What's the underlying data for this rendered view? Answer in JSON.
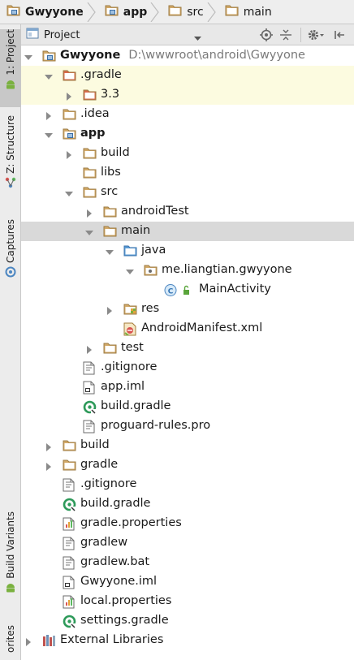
{
  "breadcrumb": {
    "items": [
      {
        "label": "Gwyyone",
        "bold": true,
        "icon": "module-folder-icon"
      },
      {
        "label": "app",
        "bold": true,
        "icon": "module-folder-icon"
      },
      {
        "label": "src",
        "bold": false,
        "icon": "folder-icon"
      },
      {
        "label": "main",
        "bold": false,
        "icon": "folder-icon"
      }
    ]
  },
  "left_strip": {
    "tabs": [
      {
        "label": "1: Project",
        "icon": "android-icon",
        "active": true
      },
      {
        "label": "Z: Structure",
        "icon": "structure-icon",
        "active": false
      },
      {
        "label": "Captures",
        "icon": "captures-icon",
        "active": false
      },
      {
        "label": "Build Variants",
        "icon": "android-icon",
        "active": false
      },
      {
        "label": "orites",
        "icon": "favorites-icon",
        "active": false
      }
    ]
  },
  "project_toolbar": {
    "view_select": "Project",
    "icons": [
      "locate-icon",
      "collapse-all-icon",
      "gear-icon",
      "hide-icon"
    ]
  },
  "tree": {
    "rows": [
      {
        "label": "Gwyyone",
        "path": "D:\\wwwroot\\android\\Gwyyone",
        "bold": true,
        "icon": "module-folder",
        "twisty": "expanded",
        "level": 0
      },
      {
        "label": ".gradle",
        "bold": false,
        "icon": "excluded-folder",
        "twisty": "expanded",
        "level": 1,
        "highlight": true
      },
      {
        "label": "3.3",
        "bold": false,
        "icon": "excluded-folder",
        "twisty": "collapsed",
        "level": 2,
        "highlight": true
      },
      {
        "label": ".idea",
        "bold": false,
        "icon": "folder",
        "twisty": "collapsed",
        "level": 1
      },
      {
        "label": "app",
        "bold": true,
        "icon": "module-folder",
        "twisty": "expanded",
        "level": 1
      },
      {
        "label": "build",
        "bold": false,
        "icon": "folder",
        "twisty": "collapsed",
        "level": 2
      },
      {
        "label": "libs",
        "bold": false,
        "icon": "folder",
        "twisty": "none",
        "level": 2
      },
      {
        "label": "src",
        "bold": false,
        "icon": "folder",
        "twisty": "expanded",
        "level": 2
      },
      {
        "label": "androidTest",
        "bold": false,
        "icon": "folder",
        "twisty": "collapsed",
        "level": 3
      },
      {
        "label": "main",
        "bold": false,
        "icon": "folder",
        "twisty": "expanded",
        "level": 3,
        "selected": true
      },
      {
        "label": "java",
        "bold": false,
        "icon": "source-folder",
        "twisty": "expanded",
        "level": 4
      },
      {
        "label": "me.liangtian.gwyyone",
        "bold": false,
        "icon": "package-folder",
        "twisty": "expanded",
        "level": 5
      },
      {
        "label": "MainActivity",
        "bold": false,
        "icon": "class",
        "twisty": "none",
        "level": 6
      },
      {
        "label": "res",
        "bold": false,
        "icon": "resource-folder",
        "twisty": "collapsed",
        "level": 4
      },
      {
        "label": "AndroidManifest.xml",
        "bold": false,
        "icon": "manifest",
        "twisty": "none",
        "level": 4
      },
      {
        "label": "test",
        "bold": false,
        "icon": "folder",
        "twisty": "collapsed",
        "level": 3
      },
      {
        "label": ".gitignore",
        "bold": false,
        "icon": "text-file",
        "twisty": "none",
        "level": 2
      },
      {
        "label": "app.iml",
        "bold": false,
        "icon": "iml-file",
        "twisty": "none",
        "level": 2
      },
      {
        "label": "build.gradle",
        "bold": false,
        "icon": "gradle-file",
        "twisty": "none",
        "level": 2
      },
      {
        "label": "proguard-rules.pro",
        "bold": false,
        "icon": "text-file",
        "twisty": "none",
        "level": 2
      },
      {
        "label": "build",
        "bold": false,
        "icon": "folder",
        "twisty": "collapsed",
        "level": 1
      },
      {
        "label": "gradle",
        "bold": false,
        "icon": "folder",
        "twisty": "collapsed",
        "level": 1
      },
      {
        "label": ".gitignore",
        "bold": false,
        "icon": "text-file",
        "twisty": "none",
        "level": 1
      },
      {
        "label": "build.gradle",
        "bold": false,
        "icon": "gradle-file",
        "twisty": "none",
        "level": 1
      },
      {
        "label": "gradle.properties",
        "bold": false,
        "icon": "properties-file",
        "twisty": "none",
        "level": 1
      },
      {
        "label": "gradlew",
        "bold": false,
        "icon": "text-file",
        "twisty": "none",
        "level": 1
      },
      {
        "label": "gradlew.bat",
        "bold": false,
        "icon": "text-file",
        "twisty": "none",
        "level": 1
      },
      {
        "label": "Gwyyone.iml",
        "bold": false,
        "icon": "iml-file",
        "twisty": "none",
        "level": 1
      },
      {
        "label": "local.properties",
        "bold": false,
        "icon": "properties-file",
        "twisty": "none",
        "level": 1
      },
      {
        "label": "settings.gradle",
        "bold": false,
        "icon": "gradle-file",
        "twisty": "none",
        "level": 1
      },
      {
        "label": "External Libraries",
        "bold": false,
        "icon": "libraries",
        "twisty": "collapsed",
        "level": 0
      }
    ]
  },
  "colors": {
    "folder": "#d2a968",
    "excluded": "#d86a4a",
    "source": "#5a9bd5",
    "gradle": "#2e9a5a",
    "selection": "#d9d9d9",
    "highlight": "#fcfbe0"
  }
}
